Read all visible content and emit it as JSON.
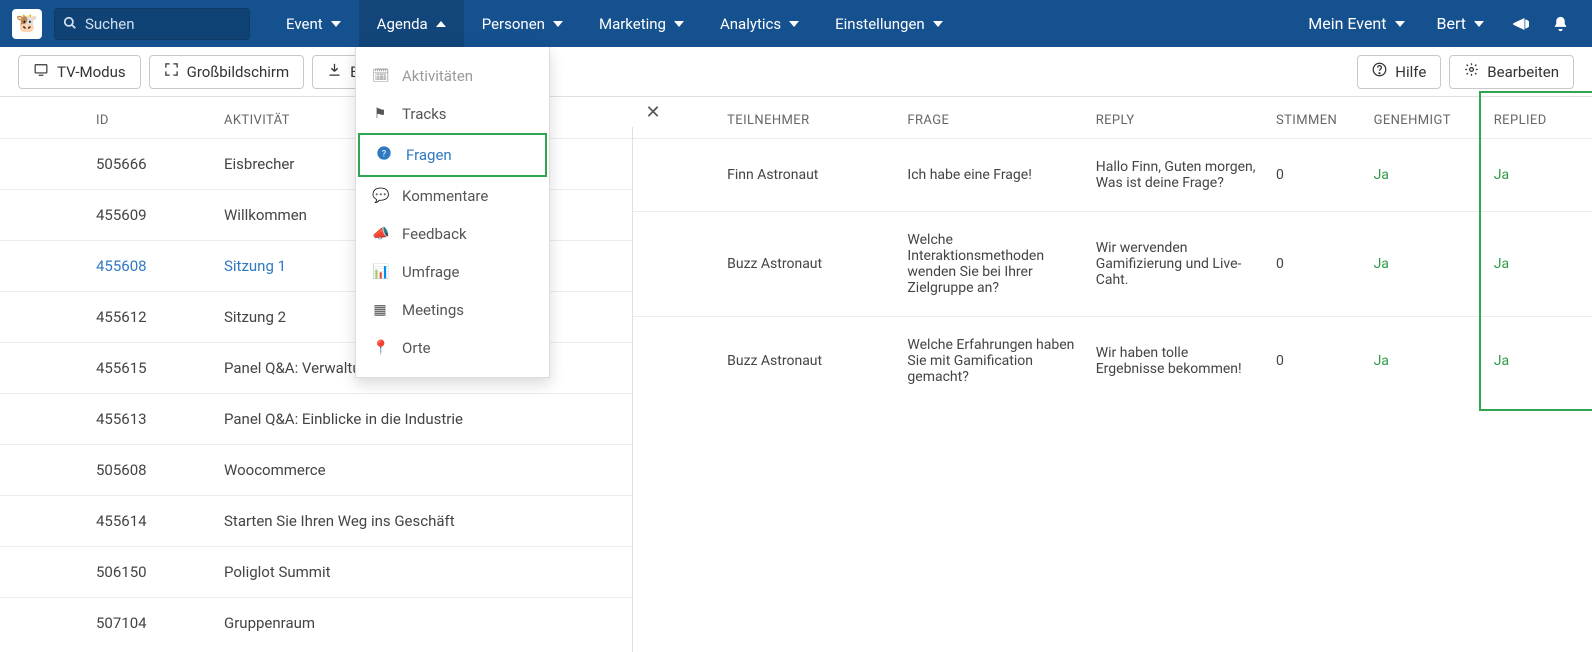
{
  "navbar": {
    "search_placeholder": "Suchen",
    "items": [
      "Event",
      "Agenda",
      "Personen",
      "Marketing",
      "Analytics",
      "Einstellungen"
    ],
    "active_index": 1,
    "right": {
      "my_event": "Mein Event",
      "user": "Bert"
    }
  },
  "toolbar": {
    "left": [
      "TV-Modus",
      "Großbildschirm",
      "Bericht"
    ],
    "right": {
      "help": "Hilfe",
      "edit": "Bearbeiten"
    }
  },
  "dropdown": {
    "items": [
      {
        "label": "Aktivitäten",
        "icon": "calendar-icon"
      },
      {
        "label": "Tracks",
        "icon": "flag-icon"
      },
      {
        "label": "Fragen",
        "icon": "question-circle-icon"
      },
      {
        "label": "Kommentare",
        "icon": "comment-icon"
      },
      {
        "label": "Feedback",
        "icon": "bullhorn-icon"
      },
      {
        "label": "Umfrage",
        "icon": "poll-icon"
      },
      {
        "label": "Meetings",
        "icon": "table-icon"
      },
      {
        "label": "Orte",
        "icon": "map-marker-icon"
      }
    ],
    "selected_index": 2
  },
  "left_table": {
    "columns": [
      "ID",
      "AKTIVITÄT"
    ],
    "rows": [
      {
        "id": "505666",
        "activity": "Eisbrecher",
        "full_activity": "Eisbrecher"
      },
      {
        "id": "455609",
        "activity": "Willkommen",
        "full_activity": "Willkommen"
      },
      {
        "id": "455608",
        "activity": "Sitzung 1",
        "full_activity": "Sitzung 1",
        "active": true
      },
      {
        "id": "455612",
        "activity": "Sitzung 2",
        "full_activity": "Sitzung 2"
      },
      {
        "id": "455615",
        "activity": "Panel Q&A: Verwaltung Ihrer Zielgruppe",
        "full_activity": "Panel Q&A: Verwaltung Ihrer Zielgruppe"
      },
      {
        "id": "455613",
        "activity": "Panel Q&A: Einblicke in die Industrie",
        "full_activity": "Panel Q&A: Einblicke in die Industrie"
      },
      {
        "id": "505608",
        "activity": "Woocommerce",
        "full_activity": "Woocommerce"
      },
      {
        "id": "455614",
        "activity": "Starten Sie Ihren Weg ins Geschäft",
        "full_activity": "Starten Sie Ihren Weg ins Geschäft"
      },
      {
        "id": "506150",
        "activity": "Poliglot Summit",
        "full_activity": "Poliglot Summit"
      },
      {
        "id": "507104",
        "activity": "Gruppenraum",
        "full_activity": "Gruppenraum"
      }
    ]
  },
  "right_table": {
    "columns": [
      "TEILNEHMER",
      "FRAGE",
      "REPLY",
      "STIMMEN",
      "GENEHMIGT",
      "REPLIED"
    ],
    "rows": [
      {
        "teilnehmer": "Finn Astronaut",
        "frage": "Ich habe eine Frage!",
        "reply": "Hallo Finn, Guten morgen, Was ist deine Frage?",
        "stimmen": "0",
        "genehmigt": "Ja",
        "replied": "Ja"
      },
      {
        "teilnehmer": "Buzz Astronaut",
        "frage": "Welche Interaktionsmethoden wenden Sie bei Ihrer Zielgruppe an?",
        "reply": "Wir wervenden Gamifizierung und Live-Caht.",
        "stimmen": "0",
        "genehmigt": "Ja",
        "replied": "Ja"
      },
      {
        "teilnehmer": "Buzz Astronaut",
        "frage": "Welche Erfahrungen haben Sie mit Gamification gemacht?",
        "reply": "Wir haben tolle Ergebnisse bekommen!",
        "stimmen": "0",
        "genehmigt": "Ja",
        "replied": "Ja"
      }
    ]
  }
}
